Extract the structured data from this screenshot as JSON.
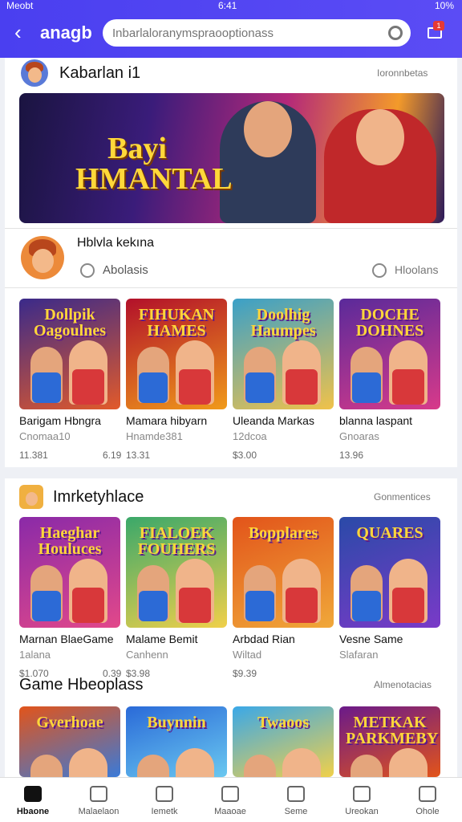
{
  "status": {
    "left": "Meobt",
    "time": "6:41",
    "right": "10%"
  },
  "header": {
    "brand": "anagb",
    "search_placeholder": "Inbarlaloranymspraooptionass"
  },
  "cart": {
    "badge": "1"
  },
  "section1": {
    "title": "Kabarlan i1",
    "link": "Ioronnbetas",
    "banner_text_1": "Bayi",
    "banner_text_2": "HMANTAL",
    "sub_title": "Hblvla kekına",
    "sub_search": "Abolasis",
    "sub_link": "Hloolans"
  },
  "tiles1": [
    {
      "art": "Dollpik Oagoulnes",
      "name": "Barigam Hbngra",
      "sub": "Cnomaa10",
      "price": "11.381",
      "extra": "6.19",
      "colors": [
        "#3a2a8a",
        "#e25a2a"
      ]
    },
    {
      "art": "FIHUKAN HAMES",
      "name": "Mamara hibyarn",
      "sub": "Hnamde381",
      "price": "13.31",
      "extra": "",
      "colors": [
        "#b2102a",
        "#f09a1a"
      ]
    },
    {
      "art": "Doolhig Haumpes",
      "name": "Uleanda Markas",
      "sub": "12dcoa",
      "price": "$3.00",
      "extra": "",
      "colors": [
        "#3aa0c8",
        "#f0c24a"
      ]
    },
    {
      "art": "DOCHE DOHNES",
      "name": "blanna laspant",
      "sub": "Gnoaras",
      "price": "13.96",
      "extra": "",
      "colors": [
        "#5a2a9a",
        "#d83a8a"
      ]
    }
  ],
  "section2": {
    "title": "Imrketyhlace",
    "link": "Gonmentices"
  },
  "tiles2": [
    {
      "art": "Haeghar Houluces",
      "name": "Marnan BlaeGame",
      "sub": "1alana",
      "price": "$1.070",
      "extra": "0.39",
      "colors": [
        "#8a2aa8",
        "#e2488a"
      ]
    },
    {
      "art": "FIALOEK FOUHERS",
      "name": "Malame Bemit",
      "sub": "Canhenn",
      "price": "$3.98",
      "extra": "",
      "colors": [
        "#3aa86a",
        "#f0d04a"
      ]
    },
    {
      "art": "Bopplares",
      "name": "Arbdad Rian",
      "sub": "Wiltad",
      "price": "$9.39",
      "extra": "",
      "colors": [
        "#e2541a",
        "#f0a83a"
      ]
    },
    {
      "art": "QUARES",
      "name": "Vesne Same",
      "sub": "Slafaran",
      "price": "",
      "extra": "",
      "colors": [
        "#2a4aa8",
        "#7a3ac8"
      ]
    }
  ],
  "section3": {
    "title": "Game Hbeoplass",
    "link": "Almenotacias"
  },
  "tiles3": [
    {
      "art": "Gverhoae",
      "colors": [
        "#e2541a",
        "#3a7ad8"
      ]
    },
    {
      "art": "Buynnin",
      "colors": [
        "#2a6ad8",
        "#6ac8f0"
      ]
    },
    {
      "art": "Twaoos",
      "colors": [
        "#3aa8e8",
        "#f0d04a"
      ]
    },
    {
      "art": "METKAK PARKMEBY",
      "colors": [
        "#6a1a8a",
        "#e2541a"
      ]
    }
  ],
  "bottom_nav": [
    "Hbaone",
    "Malaelaon",
    "Iemetk",
    "Maaoae",
    "Seme",
    "Ureokan",
    "Ohole"
  ]
}
